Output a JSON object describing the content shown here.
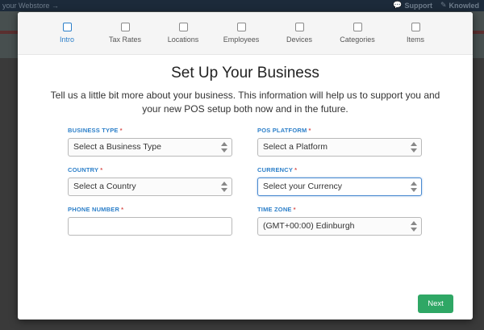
{
  "background": {
    "top_left_text": "your Webstore →",
    "support_label": "Support",
    "knowledge_label": "Knowled"
  },
  "steps": [
    {
      "label": "Intro",
      "active": true
    },
    {
      "label": "Tax Rates",
      "active": false
    },
    {
      "label": "Locations",
      "active": false
    },
    {
      "label": "Employees",
      "active": false
    },
    {
      "label": "Devices",
      "active": false
    },
    {
      "label": "Categories",
      "active": false
    },
    {
      "label": "Items",
      "active": false
    }
  ],
  "title": "Set Up Your Business",
  "description": "Tell us a little bit more about your business. This information will help us to support you and your new POS setup both now and in the future.",
  "form": {
    "business_type": {
      "label": "BUSINESS TYPE",
      "value": "Select a Business Type"
    },
    "pos_platform": {
      "label": "POS PLATFORM",
      "value": "Select a Platform"
    },
    "country": {
      "label": "COUNTRY",
      "value": "Select a Country"
    },
    "currency": {
      "label": "CURRENCY",
      "value": "Select your Currency"
    },
    "phone_number": {
      "label": "PHONE NUMBER",
      "value": ""
    },
    "time_zone": {
      "label": "TIME ZONE",
      "value": "(GMT+00:00) Edinburgh"
    },
    "required_mark": "*"
  },
  "next_label": "Next",
  "colors": {
    "accent": "#2c7fc9",
    "required": "#d9534f",
    "primary_button": "#2fa765"
  }
}
